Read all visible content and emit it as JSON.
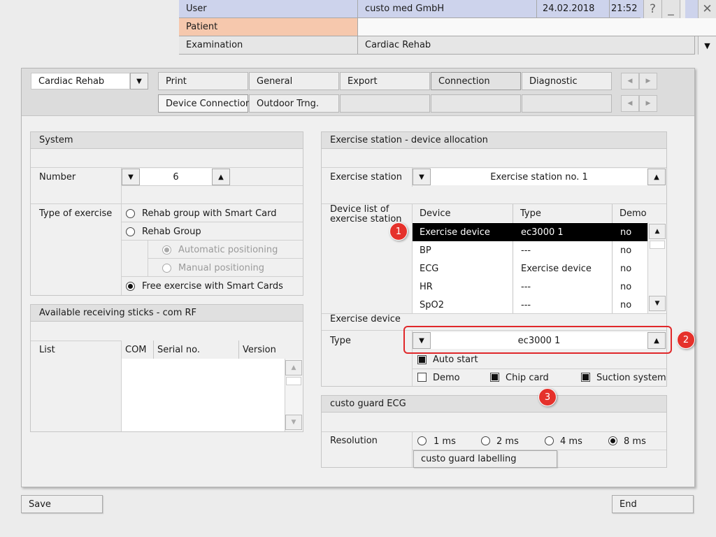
{
  "header": {
    "user_label": "User",
    "user_value": "custo med GmbH",
    "date": "24.02.2018",
    "time": "21:52",
    "help": "?",
    "minimize": "_",
    "close": "✕",
    "patient_label": "Patient",
    "patient_value": "",
    "exam_label": "Examination",
    "exam_value": "Cardiac Rehab"
  },
  "toolbar": {
    "module_value": "Cardiac Rehab",
    "tabs_row1": [
      "Print",
      "General",
      "Export",
      "Connection",
      "Diagnostic"
    ],
    "tabs_row2": [
      "Device Connection",
      "Outdoor Trng.",
      "",
      "",
      ""
    ],
    "active_tab": "Connection"
  },
  "system": {
    "title": "System",
    "number_label": "Number",
    "number_value": "6",
    "type_label": "Type of exercise",
    "options": [
      {
        "label": "Rehab group with Smart Card",
        "selected": false,
        "enabled": true
      },
      {
        "label": "Rehab Group",
        "selected": false,
        "enabled": true
      },
      {
        "label": "Automatic positioning",
        "selected": true,
        "enabled": false
      },
      {
        "label": "Manual positioning",
        "selected": false,
        "enabled": false
      },
      {
        "label": "Free exercise with Smart Cards",
        "selected": true,
        "enabled": true
      }
    ]
  },
  "sticks": {
    "title": "Available receiving sticks - com RF",
    "list_label": "List",
    "columns": [
      "COM",
      "Serial no.",
      "Version"
    ]
  },
  "allocation": {
    "title": "Exercise station - device allocation",
    "station_label": "Exercise station",
    "station_value": "Exercise station no. 1",
    "device_list_label": "Device list of exercise station",
    "columns": [
      "Device",
      "Type",
      "Demo"
    ],
    "rows": [
      {
        "device": "Exercise device",
        "type": "ec3000 1",
        "demo": "no",
        "selected": true
      },
      {
        "device": "BP",
        "type": "---",
        "demo": "no",
        "selected": false
      },
      {
        "device": "ECG",
        "type": "Exercise device",
        "demo": "no",
        "selected": false
      },
      {
        "device": "HR",
        "type": "---",
        "demo": "no",
        "selected": false
      },
      {
        "device": "SpO2",
        "type": "---",
        "demo": "no",
        "selected": false
      }
    ],
    "exercise_device_label": "Exercise device",
    "type_label": "Type",
    "type_value": "ec3000 1",
    "checkboxes": [
      {
        "label": "Auto start",
        "checked": true
      },
      {
        "label": "Demo",
        "checked": false
      },
      {
        "label": "Chip card",
        "checked": true
      },
      {
        "label": "Suction system",
        "checked": true
      }
    ]
  },
  "guard": {
    "title": "custo guard ECG",
    "resolution_label": "Resolution",
    "resolutions": [
      {
        "label": "1 ms",
        "selected": false
      },
      {
        "label": "2 ms",
        "selected": false
      },
      {
        "label": "4 ms",
        "selected": false
      },
      {
        "label": "8 ms",
        "selected": true
      }
    ],
    "labelling_button": "custo guard labelling"
  },
  "markers": [
    "1",
    "2",
    "3"
  ],
  "footer": {
    "save": "Save",
    "end": "End"
  },
  "colors": {
    "user_bar": "#cdd3ec",
    "patient_bar": "#f6c8ad",
    "marker": "#e5312b",
    "highlight_box": "#e0282a"
  }
}
